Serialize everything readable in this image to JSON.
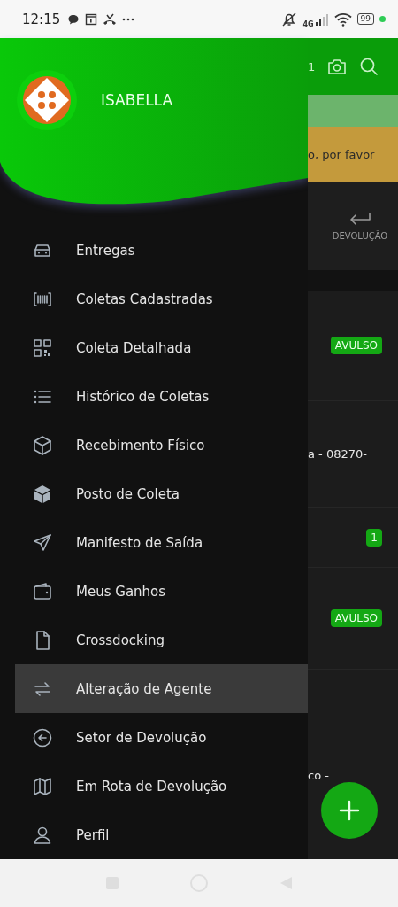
{
  "status_bar": {
    "time": "12:15",
    "network": "4G",
    "battery": "99"
  },
  "drawer": {
    "user_name": "ISABELLA",
    "items": [
      {
        "label": "Entregas",
        "selected": false
      },
      {
        "label": "Coletas Cadastradas",
        "selected": false
      },
      {
        "label": "Coleta Detalhada",
        "selected": false
      },
      {
        "label": "Histórico de Coletas",
        "selected": false
      },
      {
        "label": "Recebimento Físico",
        "selected": false
      },
      {
        "label": "Posto de Coleta",
        "selected": false
      },
      {
        "label": "Manifesto de Saída",
        "selected": false
      },
      {
        "label": "Meus Ganhos",
        "selected": false
      },
      {
        "label": "Crossdocking",
        "selected": false
      },
      {
        "label": "Alteração de Agente",
        "selected": true
      },
      {
        "label": "Setor de Devolução",
        "selected": false
      },
      {
        "label": "Em Rota de Devolução",
        "selected": false
      },
      {
        "label": "Perfil",
        "selected": false
      }
    ]
  },
  "background_screen": {
    "toolbar_text": "1",
    "banner_text": "o, por favor",
    "tab_label": "DEVOLUÇÃO",
    "list": [
      {
        "kind": "badge",
        "text": "AVULSO"
      },
      {
        "kind": "text",
        "text": "a - 08270-"
      },
      {
        "kind": "badge",
        "text": "1"
      },
      {
        "kind": "badge",
        "text": "AVULSO"
      },
      {
        "kind": "text",
        "text": "co -"
      }
    ]
  }
}
